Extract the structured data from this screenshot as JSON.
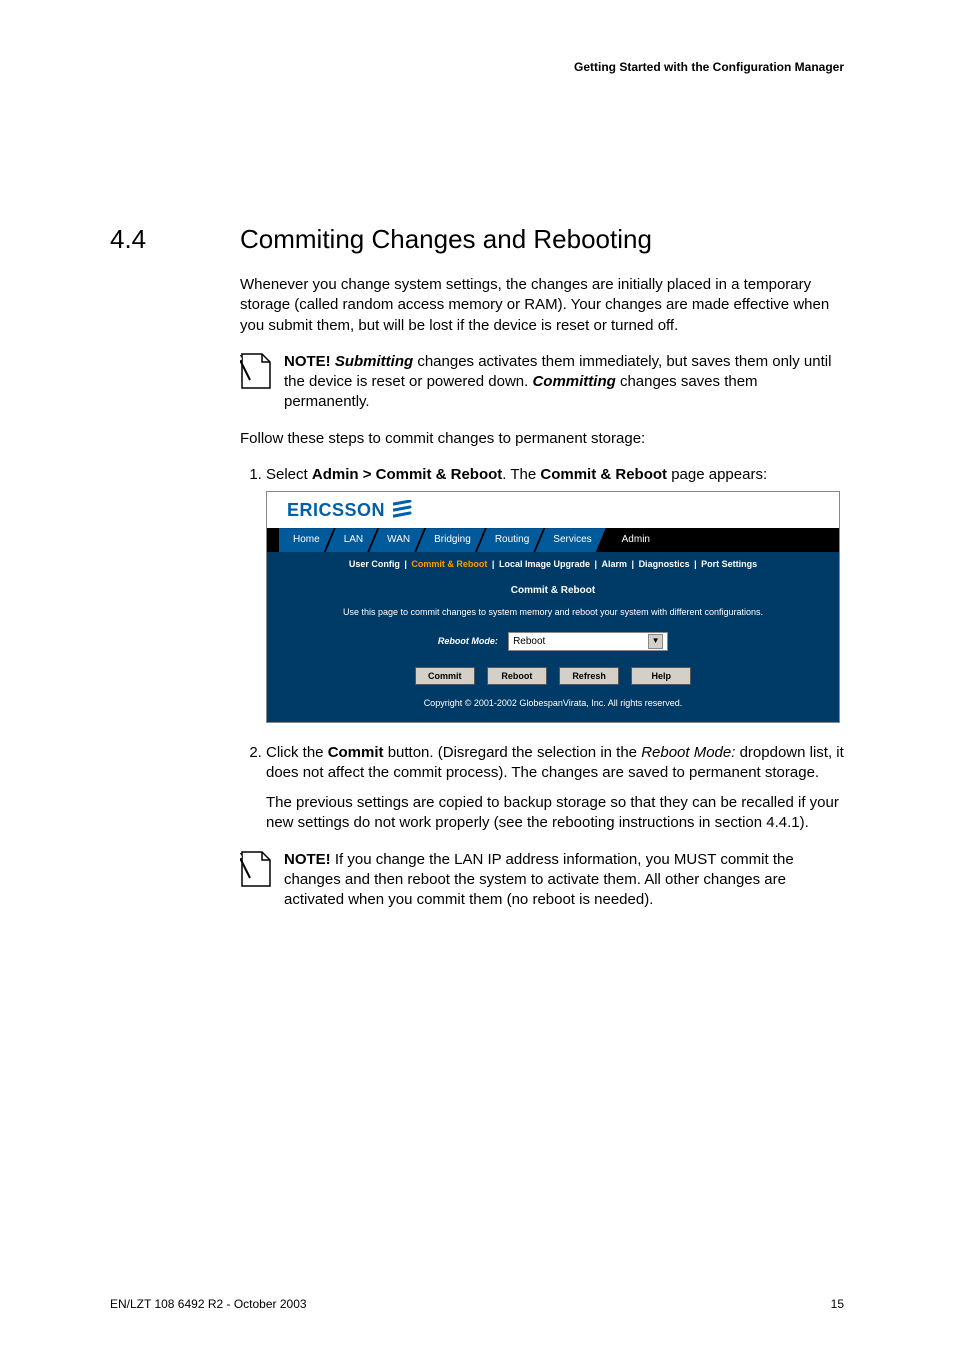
{
  "header": {
    "running": "Getting Started with the Configuration Manager"
  },
  "section": {
    "num": "4.4",
    "title": "Commiting Changes and Rebooting"
  },
  "intro": "Whenever you change system settings, the changes are initially placed in a temporary storage (called random access memory or RAM). Your changes are made effective when you submit them, but will be lost if the device is reset or turned off.",
  "note1": {
    "prefix": "NOTE! ",
    "b1": "Submitting",
    "mid1": " changes activates them immediately, but saves them only until the device is reset or powered down. ",
    "b2": "Committing",
    "mid2": " changes saves them permanently."
  },
  "follow": "Follow these steps to commit changes to permanent storage:",
  "steps": {
    "s1a": "Select ",
    "s1b": "Admin > Commit & Reboot",
    "s1c": ". The ",
    "s1d": "Commit & Reboot",
    "s1e": " page appears:",
    "s2a": "Click the ",
    "s2b": "Commit",
    "s2c": " button. (Disregard the selection in the ",
    "s2d": "Reboot Mode:",
    "s2e": " dropdown list, it does not affect the commit process). The changes are saved to permanent storage.",
    "s2f": "The previous settings are copied to backup storage so that they can be recalled if your new settings do not work properly (see the rebooting instructions in section 4.4.1)."
  },
  "note2": {
    "prefix": "NOTE! ",
    "text": "If you change the LAN IP address information, you MUST commit the changes and then reboot the system to activate them. All other changes are activated when you commit them (no reboot is needed)."
  },
  "screenshot": {
    "logo": "ERICSSON",
    "tabs": {
      "home": "Home",
      "lan": "LAN",
      "wan": "WAN",
      "bridging": "Bridging",
      "routing": "Routing",
      "services": "Services",
      "admin": "Admin"
    },
    "subnav": {
      "user": "User Config",
      "commit": "Commit & Reboot",
      "image": "Local Image Upgrade",
      "alarm": "Alarm",
      "diag": "Diagnostics",
      "port": "Port Settings"
    },
    "panel_title": "Commit & Reboot",
    "panel_desc": "Use this page to commit changes to system memory and reboot your system with different configurations.",
    "mode_label": "Reboot Mode:",
    "mode_value": "Reboot",
    "buttons": {
      "commit": "Commit",
      "reboot": "Reboot",
      "refresh": "Refresh",
      "help": "Help"
    },
    "copyright": "Copyright © 2001-2002 GlobespanVirata, Inc. All rights reserved."
  },
  "footer": {
    "left": "EN/LZT 108 6492 R2 - October 2003",
    "right": "15"
  }
}
